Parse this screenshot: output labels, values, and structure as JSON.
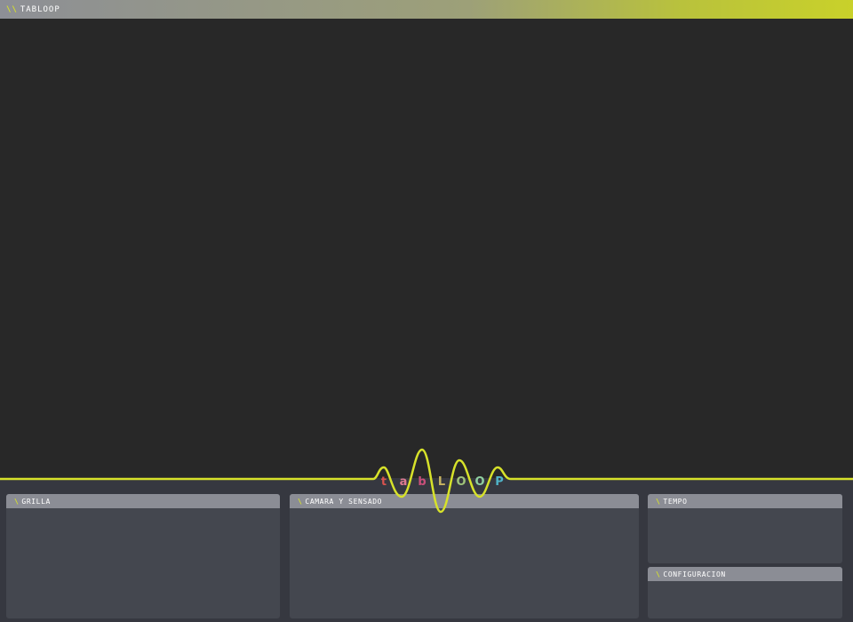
{
  "window": {
    "title": "TABLOOP",
    "title_slash": "\\\\"
  },
  "logo": {
    "letters": [
      {
        "char": "t",
        "color": "#d9534f"
      },
      {
        "char": "a",
        "color": "#e07b91"
      },
      {
        "char": "b",
        "color": "#c94f7a"
      },
      {
        "char": "L",
        "color": "#c9b560"
      },
      {
        "char": "O",
        "color": "#9fc37a"
      },
      {
        "char": "O",
        "color": "#8fd0a0"
      },
      {
        "char": "P",
        "color": "#4fb3c9"
      }
    ],
    "wave_color": "#d7e22a"
  },
  "panels": {
    "grilla": {
      "slash": "\\",
      "title": "GRILLA"
    },
    "camara": {
      "slash": "\\",
      "title": "CAMARA Y SENSADO"
    },
    "tempo": {
      "slash": "\\",
      "title": "TEMPO"
    },
    "configuracion": {
      "slash": "\\",
      "title": "CONFIGURACION"
    }
  },
  "colors": {
    "accent": "#d7e22a",
    "background": "#282828",
    "panel": "#44474f",
    "panel_header": "#8b8d95"
  }
}
